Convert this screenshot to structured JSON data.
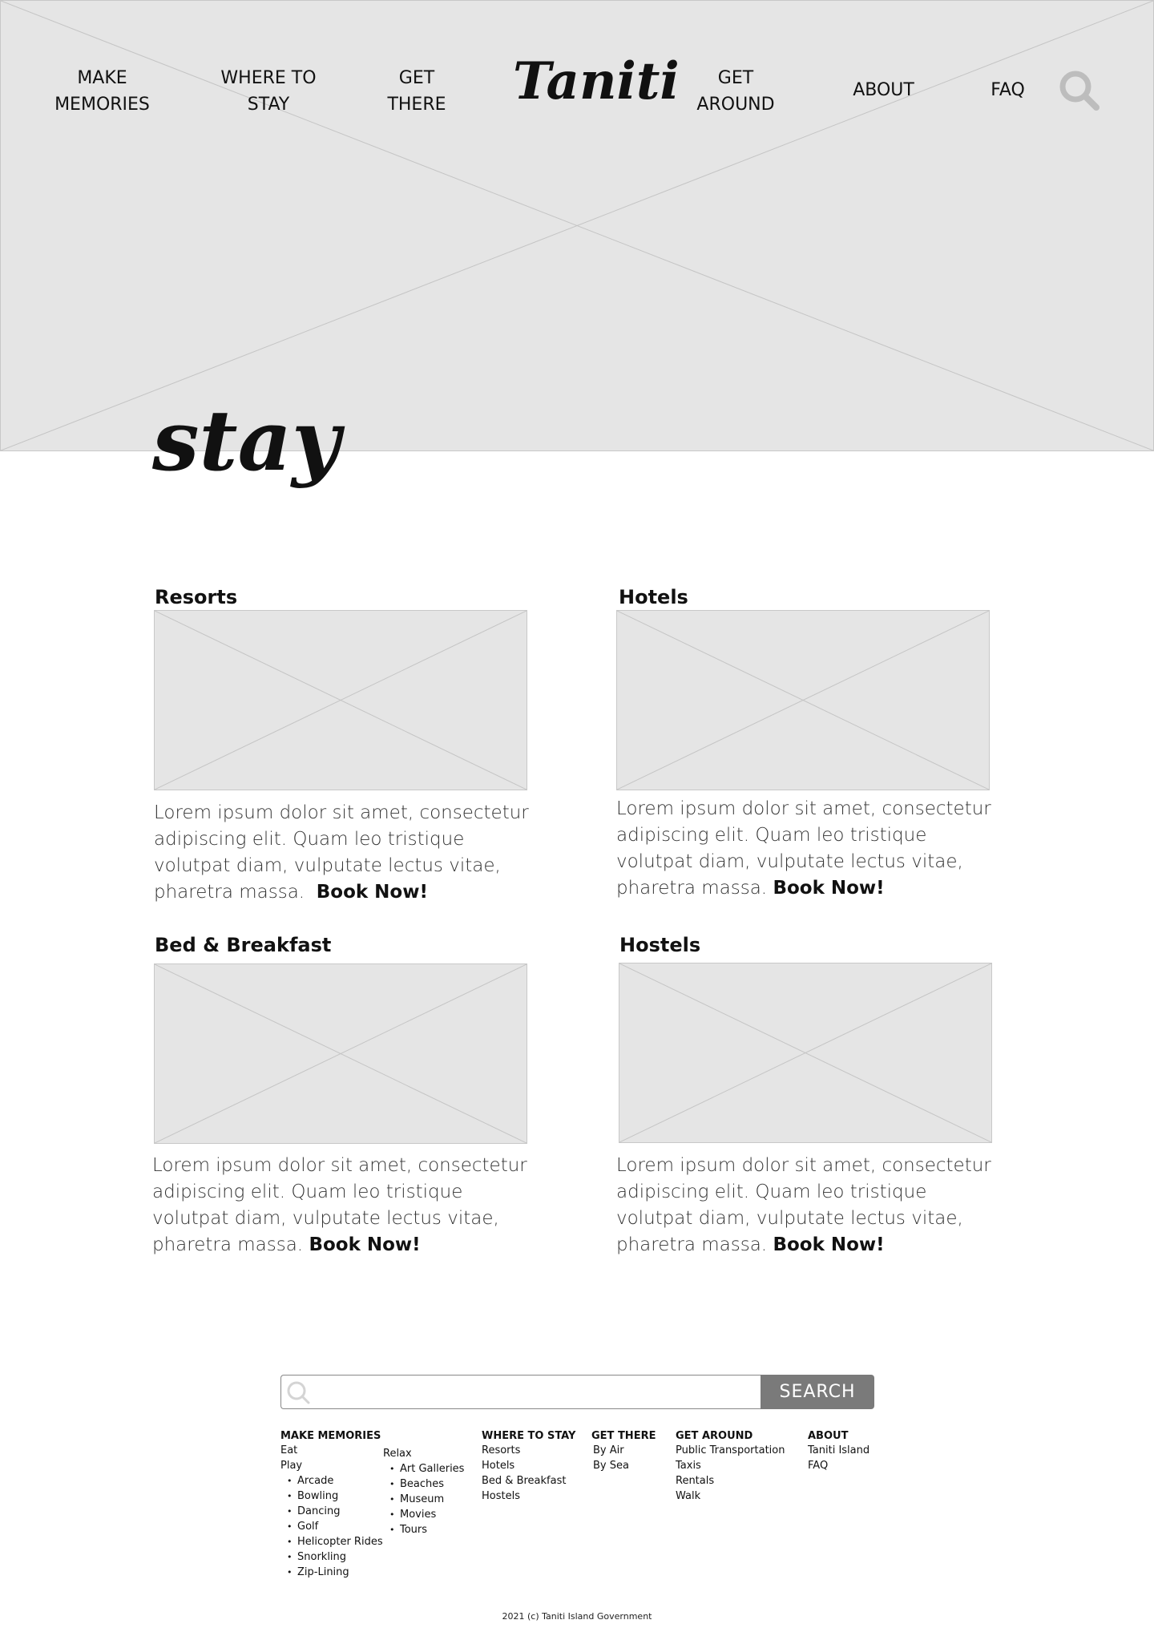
{
  "header": {
    "nav_left": [
      "MAKE MEMORIES",
      "WHERE TO STAY",
      "GET THERE"
    ],
    "logo": "Taniti",
    "nav_right": [
      "GET AROUND",
      "ABOUT",
      "FAQ"
    ],
    "search_icon": "search-icon"
  },
  "page": {
    "title": "stay"
  },
  "cards": [
    {
      "title": "Resorts",
      "body": "Lorem ipsum dolor sit amet, consectetur adipiscing elit. Quam leo tristique volutpat diam, vulputate lectus vitae, pharetra massa.",
      "cta": "Book Now!"
    },
    {
      "title": "Hotels",
      "body": "Lorem ipsum dolor sit amet, consectetur adipiscing elit. Quam leo tristique volutpat diam, vulputate lectus vitae, pharetra massa.",
      "cta": "Book Now!"
    },
    {
      "title": "Bed & Breakfast",
      "body": "Lorem ipsum dolor sit amet, consectetur adipiscing elit. Quam leo tristique volutpat diam, vulputate lectus vitae, pharetra massa.",
      "cta": "Book Now!"
    },
    {
      "title": "Hostels",
      "body": "Lorem ipsum dolor sit amet, consectetur adipiscing elit. Quam leo tristique volutpat diam, vulputate lectus vitae, pharetra massa.",
      "cta": "Book Now!"
    }
  ],
  "footer": {
    "search": {
      "placeholder": "",
      "button": "SEARCH"
    },
    "make_memories": {
      "heading": "MAKE MEMORIES",
      "eat": "Eat",
      "play": "Play",
      "play_items": [
        "Arcade",
        "Bowling",
        "Dancing",
        "Golf",
        "Helicopter Rides",
        "Snorkling",
        "Zip-Lining"
      ],
      "relax": "Relax",
      "relax_items": [
        "Art Galleries",
        "Beaches",
        "Museum",
        "Movies",
        "Tours"
      ]
    },
    "where_to_stay": {
      "heading": "WHERE TO STAY",
      "links": [
        "Resorts",
        "Hotels",
        "Bed & Breakfast",
        "Hostels"
      ]
    },
    "get_there": {
      "heading": "GET THERE",
      "links": [
        "By Air",
        "By Sea"
      ]
    },
    "get_around": {
      "heading": "GET AROUND",
      "links": [
        "Public Transportation",
        "Taxis",
        "Rentals",
        "Walk"
      ]
    },
    "about": {
      "heading": "ABOUT",
      "links": [
        "Taniti Island",
        "FAQ"
      ]
    },
    "copyright": "2021 (c) Taniti Island Government"
  },
  "colors": {
    "placeholder_bg": "#e5e5e5",
    "search_button": "#7a7a7a",
    "text": "#111111"
  }
}
